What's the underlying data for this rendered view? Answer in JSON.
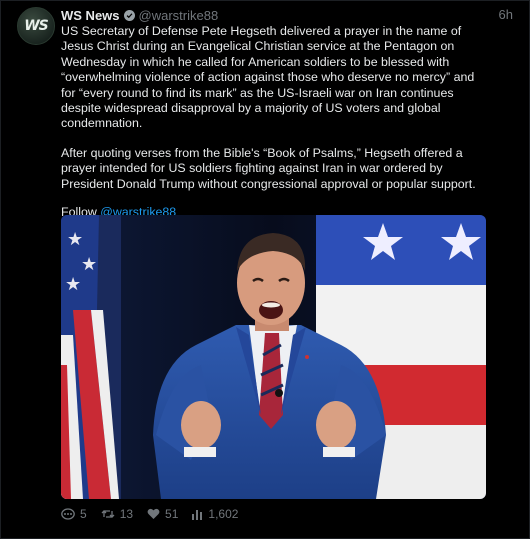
{
  "author": {
    "name": "WS News",
    "handle": "@warstrike88",
    "avatar_text": "WS",
    "avatar_icon": "ws-news-logo-icon"
  },
  "timestamp": "6h",
  "paragraphs": [
    "US Secretary of Defense Pete Hegseth delivered a prayer in the name of Jesus Christ during an Evangelical Christian service at the Pentagon on Wednesday in which he called for American soldiers to be blessed with “overwhelming violence of action against those who deserve no mercy” and for “every round to find its mark” as the US-Israeli war on Iran continues despite widespread disapproval by a majority of US voters and global condemnation.",
    "After quoting verses from the Bible's “Book of Psalms,” Hegseth offered a prayer intended for US soldiers fighting against Iran in war ordered by President Donald Trump without congressional approval or popular support."
  ],
  "follow": {
    "prefix": "Follow",
    "handle": "@warstrike88"
  },
  "stats": {
    "replies": "5",
    "retweets": "13",
    "likes": "51",
    "views": "1,602"
  },
  "colors": {
    "background": "#000000",
    "text": "#e7e9ea",
    "muted": "#71767b",
    "link": "#1d9bf0"
  }
}
